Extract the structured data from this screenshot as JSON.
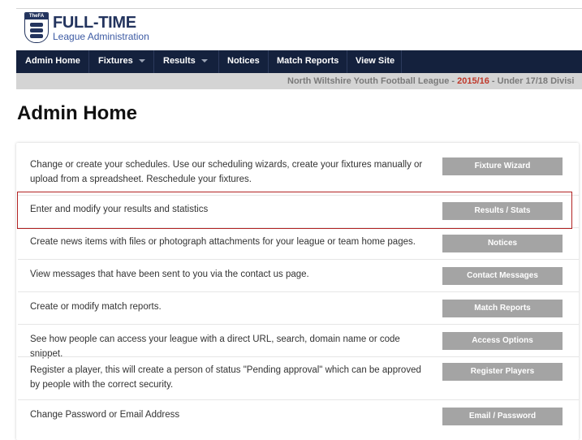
{
  "logo": {
    "badge": "TheFA",
    "title": "FULL-TIME",
    "subtitle": "League Administration"
  },
  "nav": {
    "items": [
      {
        "label": "Admin Home",
        "dropdown": false
      },
      {
        "label": "Fixtures",
        "dropdown": true
      },
      {
        "label": "Results",
        "dropdown": true
      },
      {
        "label": "Notices",
        "dropdown": false
      },
      {
        "label": "Match Reports",
        "dropdown": false
      },
      {
        "label": "View Site",
        "dropdown": false
      }
    ]
  },
  "subbar": {
    "league": "North Wiltshire Youth Football League",
    "dash1": " - ",
    "season": "2015/16",
    "dash2": " - ",
    "division": "Under 17/18 Divisi"
  },
  "page": {
    "title": "Admin Home"
  },
  "rows": [
    {
      "text": "Change or create your schedules. Use our scheduling wizards, create your fixtures manually or upload from a spreadsheet. Reschedule your fixtures.",
      "button": "Fixture Wizard"
    },
    {
      "text": "Enter and modify your results and statistics",
      "button": "Results / Stats"
    },
    {
      "text": "Create news items with files or photograph attachments for your league or team home pages.",
      "button": "Notices"
    },
    {
      "text": "View messages that have been sent to you via the contact us page.",
      "button": "Contact Messages"
    },
    {
      "text": "Create or modify match reports.",
      "button": "Match Reports"
    },
    {
      "text": "See how people can access your league with a direct URL, search, domain name or code snippet.",
      "button": "Access Options"
    },
    {
      "text": "Register a player, this will create a person of status \"Pending approval\" which can be approved by people with the correct security.",
      "button": "Register Players"
    },
    {
      "text": "Change Password or Email Address",
      "button": "Email / Password"
    }
  ],
  "colors": {
    "nav_bg": "#14213d",
    "subbar_bg": "#d4d4d4",
    "season_red": "#c0392b",
    "button_bg": "#a4a4a4",
    "highlight_border": "#b22222"
  }
}
